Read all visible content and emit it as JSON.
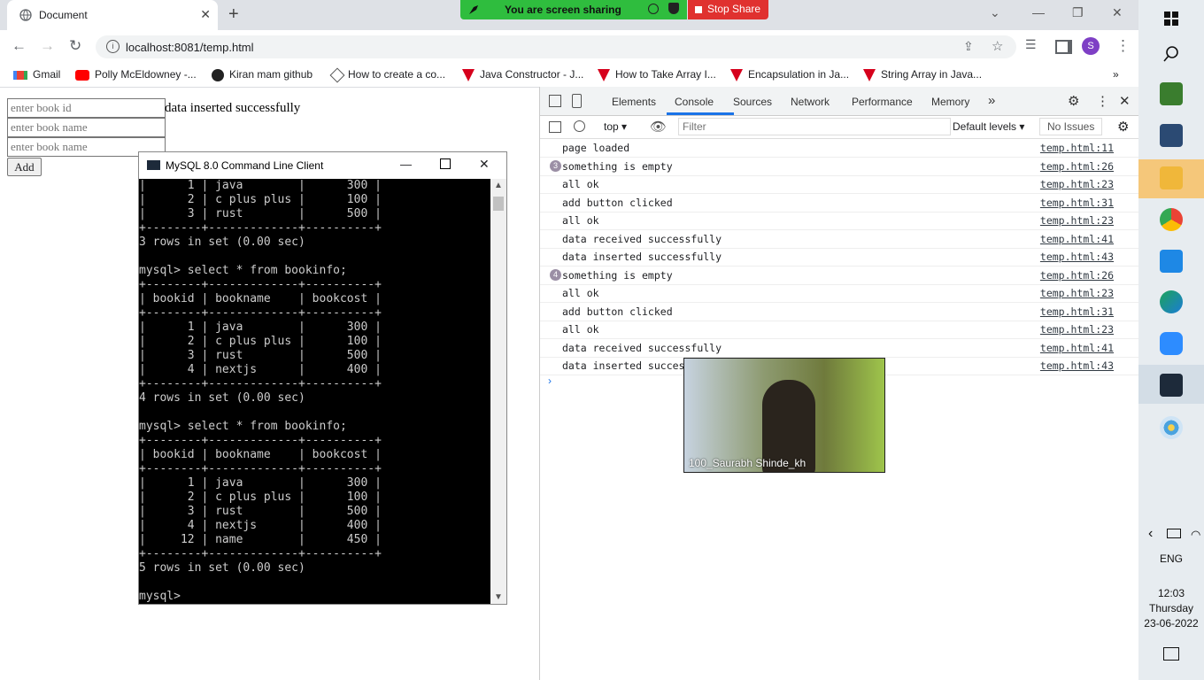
{
  "browser": {
    "tab_title": "Document",
    "url": "localhost:8081/temp.html",
    "profile_initial": "S",
    "screen_share_label": "You are screen sharing",
    "stop_share_label": "Stop Share",
    "bookmarks": [
      "Gmail",
      "Polly McEldowney -...",
      "Kiran mam github",
      "How to create a co...",
      "Java Constructor - J...",
      "How to Take Array I...",
      "Encapsulation in Ja...",
      "String Array in Java..."
    ]
  },
  "page": {
    "inputs": [
      {
        "placeholder": "enter book id"
      },
      {
        "placeholder": "enter book name"
      },
      {
        "placeholder": "enter book name"
      }
    ],
    "add_label": "Add",
    "message": "data inserted successfully"
  },
  "mysql_window": {
    "title": "MySQL 8.0 Command Line Client",
    "lines": [
      "|      1 | java        |      300 |",
      "|      2 | c plus plus |      100 |",
      "|      3 | rust        |      500 |",
      "+--------+-------------+----------+",
      "3 rows in set (0.00 sec)",
      "",
      "mysql> select * from bookinfo;",
      "+--------+-------------+----------+",
      "| bookid | bookname    | bookcost |",
      "+--------+-------------+----------+",
      "|      1 | java        |      300 |",
      "|      2 | c plus plus |      100 |",
      "|      3 | rust        |      500 |",
      "|      4 | nextjs      |      400 |",
      "+--------+-------------+----------+",
      "4 rows in set (0.00 sec)",
      "",
      "mysql> select * from bookinfo;",
      "+--------+-------------+----------+",
      "| bookid | bookname    | bookcost |",
      "+--------+-------------+----------+",
      "|      1 | java        |      300 |",
      "|      2 | c plus plus |      100 |",
      "|      3 | rust        |      500 |",
      "|      4 | nextjs      |      400 |",
      "|     12 | name        |      450 |",
      "+--------+-------------+----------+",
      "5 rows in set (0.00 sec)",
      "",
      "mysql>"
    ]
  },
  "devtools": {
    "tabs": [
      "Elements",
      "Console",
      "Sources",
      "Network",
      "Performance",
      "Memory"
    ],
    "active_tab": "Console",
    "context": "top",
    "filter_placeholder": "Filter",
    "levels": "Default levels",
    "issues": "No Issues",
    "logs": [
      {
        "count": "",
        "msg": "page loaded",
        "src": "temp.html:11"
      },
      {
        "count": "3",
        "msg": "something is empty",
        "src": "temp.html:26"
      },
      {
        "count": "",
        "msg": "all ok",
        "src": "temp.html:23"
      },
      {
        "count": "",
        "msg": "add button clicked",
        "src": "temp.html:31"
      },
      {
        "count": "",
        "msg": "all ok",
        "src": "temp.html:23"
      },
      {
        "count": "",
        "msg": "data received successfully",
        "src": "temp.html:41"
      },
      {
        "count": "",
        "msg": "data inserted successfully",
        "src": "temp.html:43"
      },
      {
        "count": "4",
        "msg": "something is empty",
        "src": "temp.html:26"
      },
      {
        "count": "",
        "msg": "all ok",
        "src": "temp.html:23"
      },
      {
        "count": "",
        "msg": "add button clicked",
        "src": "temp.html:31"
      },
      {
        "count": "",
        "msg": "all ok",
        "src": "temp.html:23"
      },
      {
        "count": "",
        "msg": "data received successfully",
        "src": "temp.html:41"
      },
      {
        "count": "",
        "msg": "data inserted successfully",
        "src": "temp.html:43"
      }
    ]
  },
  "video": {
    "participant": "100_Saurabh Shinde_kh"
  },
  "taskbar": {
    "language": "ENG",
    "time": "12:03",
    "day": "Thursday",
    "date": "23-06-2022",
    "icons": [
      "windows-start-icon",
      "search-icon",
      "spreadsheet-app-icon",
      "sql-tool-icon",
      "file-explorer-icon",
      "chrome-icon",
      "vscode-icon",
      "edge-icon",
      "zoom-icon",
      "mysql-client-icon",
      "paint-icon"
    ]
  }
}
